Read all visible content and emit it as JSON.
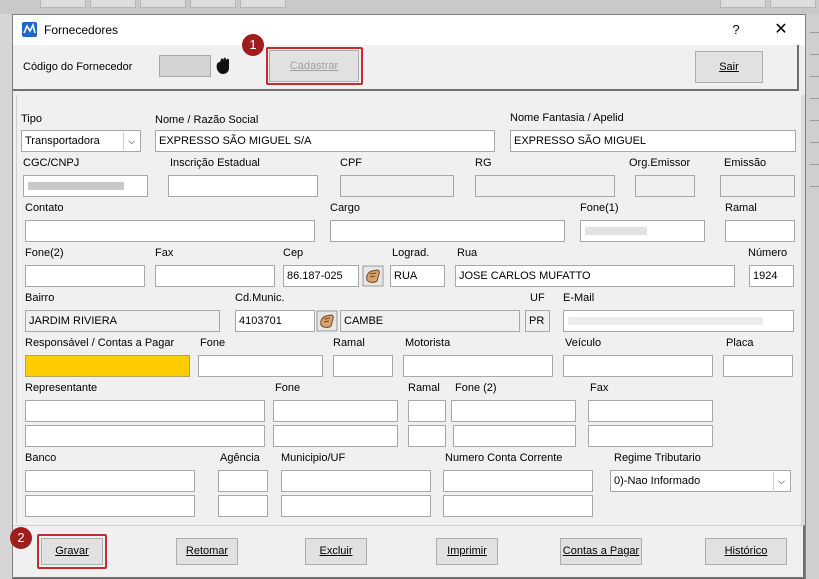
{
  "window": {
    "title": "Fornecedores",
    "help_label": "?",
    "close_label": "✕"
  },
  "header": {
    "codigo_label": "Código do Fornecedor",
    "codigo_value": "",
    "cadastrar_label": "Cadastrar",
    "sair_label": "Sair",
    "badge1": "1"
  },
  "form": {
    "tipo_label": "Tipo",
    "tipo_value": "Transportadora",
    "nome_label": "Nome / Razão Social",
    "nome_value": "EXPRESSO SÃO MIGUEL S/A",
    "fantasia_label": "Nome Fantasia / Apelid",
    "fantasia_value": "EXPRESSO SÃO MIGUEL",
    "cgc_label": "CGC/CNPJ",
    "ie_label": "Inscrição Estadual",
    "cpf_label": "CPF",
    "rg_label": "RG",
    "orgemissor_label": "Org.Emissor",
    "emissao_label": "Emissão",
    "contato_label": "Contato",
    "cargo_label": "Cargo",
    "fone1_label": "Fone(1)",
    "ramal1_label": "Ramal",
    "fone2_label": "Fone(2)",
    "fax_label": "Fax",
    "cep_label": "Cep",
    "cep_value": "86.187-025",
    "lograd_label": "Lograd.",
    "lograd_value": "RUA",
    "rua_label": "Rua",
    "rua_value": "JOSE CARLOS MUFATTO",
    "numero_label": "Número",
    "numero_value": "1924",
    "bairro_label": "Bairro",
    "bairro_value": "JARDIM RIVIERA",
    "cdmunic_label": "Cd.Munic.",
    "cdmunic_value": "4103701",
    "cidade_value": "CAMBE",
    "uf_label": "UF",
    "uf_value": "PR",
    "email_label": "E-Mail",
    "resp_label": "Responsável / Contas a Pagar",
    "resp_fone_label": "Fone",
    "resp_ramal_label": "Ramal",
    "motorista_label": "Motorista",
    "veiculo_label": "Veículo",
    "placa_label": "Placa",
    "repr_label": "Representante",
    "repr_fone_label": "Fone",
    "repr_ramal_label": "Ramal",
    "repr_fone2_label": "Fone (2)",
    "repr_fax_label": "Fax",
    "banco_label": "Banco",
    "agencia_label": "Agência",
    "municipio_label": "Municipio/UF",
    "conta_label": "Numero Conta Corrente",
    "regime_label": "Regime Tributario",
    "regime_value": "0)-Nao Informado"
  },
  "footer": {
    "gravar_label": "Gravar",
    "retomar_label": "Retomar",
    "excluir_label": "Excluir",
    "imprimir_label": "Imprimir",
    "contas_label": "Contas a Pagar",
    "historico_label": "Histórico",
    "badge2": "2"
  },
  "colors": {
    "accent_red": "#c42b2b",
    "badge_red": "#a11d1d",
    "highlight_yellow": "#ffcc00"
  }
}
